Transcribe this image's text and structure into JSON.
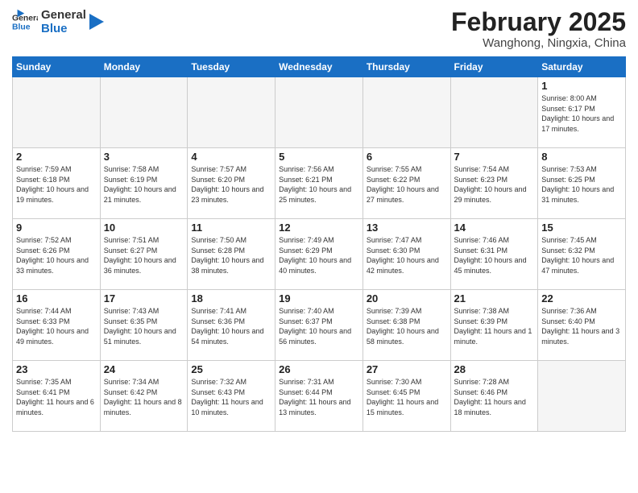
{
  "header": {
    "logo_general": "General",
    "logo_blue": "Blue",
    "month": "February 2025",
    "location": "Wanghong, Ningxia, China"
  },
  "weekdays": [
    "Sunday",
    "Monday",
    "Tuesday",
    "Wednesday",
    "Thursday",
    "Friday",
    "Saturday"
  ],
  "weeks": [
    [
      {
        "day": "",
        "info": ""
      },
      {
        "day": "",
        "info": ""
      },
      {
        "day": "",
        "info": ""
      },
      {
        "day": "",
        "info": ""
      },
      {
        "day": "",
        "info": ""
      },
      {
        "day": "",
        "info": ""
      },
      {
        "day": "1",
        "info": "Sunrise: 8:00 AM\nSunset: 6:17 PM\nDaylight: 10 hours\nand 17 minutes."
      }
    ],
    [
      {
        "day": "2",
        "info": "Sunrise: 7:59 AM\nSunset: 6:18 PM\nDaylight: 10 hours\nand 19 minutes."
      },
      {
        "day": "3",
        "info": "Sunrise: 7:58 AM\nSunset: 6:19 PM\nDaylight: 10 hours\nand 21 minutes."
      },
      {
        "day": "4",
        "info": "Sunrise: 7:57 AM\nSunset: 6:20 PM\nDaylight: 10 hours\nand 23 minutes."
      },
      {
        "day": "5",
        "info": "Sunrise: 7:56 AM\nSunset: 6:21 PM\nDaylight: 10 hours\nand 25 minutes."
      },
      {
        "day": "6",
        "info": "Sunrise: 7:55 AM\nSunset: 6:22 PM\nDaylight: 10 hours\nand 27 minutes."
      },
      {
        "day": "7",
        "info": "Sunrise: 7:54 AM\nSunset: 6:23 PM\nDaylight: 10 hours\nand 29 minutes."
      },
      {
        "day": "8",
        "info": "Sunrise: 7:53 AM\nSunset: 6:25 PM\nDaylight: 10 hours\nand 31 minutes."
      }
    ],
    [
      {
        "day": "9",
        "info": "Sunrise: 7:52 AM\nSunset: 6:26 PM\nDaylight: 10 hours\nand 33 minutes."
      },
      {
        "day": "10",
        "info": "Sunrise: 7:51 AM\nSunset: 6:27 PM\nDaylight: 10 hours\nand 36 minutes."
      },
      {
        "day": "11",
        "info": "Sunrise: 7:50 AM\nSunset: 6:28 PM\nDaylight: 10 hours\nand 38 minutes."
      },
      {
        "day": "12",
        "info": "Sunrise: 7:49 AM\nSunset: 6:29 PM\nDaylight: 10 hours\nand 40 minutes."
      },
      {
        "day": "13",
        "info": "Sunrise: 7:47 AM\nSunset: 6:30 PM\nDaylight: 10 hours\nand 42 minutes."
      },
      {
        "day": "14",
        "info": "Sunrise: 7:46 AM\nSunset: 6:31 PM\nDaylight: 10 hours\nand 45 minutes."
      },
      {
        "day": "15",
        "info": "Sunrise: 7:45 AM\nSunset: 6:32 PM\nDaylight: 10 hours\nand 47 minutes."
      }
    ],
    [
      {
        "day": "16",
        "info": "Sunrise: 7:44 AM\nSunset: 6:33 PM\nDaylight: 10 hours\nand 49 minutes."
      },
      {
        "day": "17",
        "info": "Sunrise: 7:43 AM\nSunset: 6:35 PM\nDaylight: 10 hours\nand 51 minutes."
      },
      {
        "day": "18",
        "info": "Sunrise: 7:41 AM\nSunset: 6:36 PM\nDaylight: 10 hours\nand 54 minutes."
      },
      {
        "day": "19",
        "info": "Sunrise: 7:40 AM\nSunset: 6:37 PM\nDaylight: 10 hours\nand 56 minutes."
      },
      {
        "day": "20",
        "info": "Sunrise: 7:39 AM\nSunset: 6:38 PM\nDaylight: 10 hours\nand 58 minutes."
      },
      {
        "day": "21",
        "info": "Sunrise: 7:38 AM\nSunset: 6:39 PM\nDaylight: 11 hours\nand 1 minute."
      },
      {
        "day": "22",
        "info": "Sunrise: 7:36 AM\nSunset: 6:40 PM\nDaylight: 11 hours\nand 3 minutes."
      }
    ],
    [
      {
        "day": "23",
        "info": "Sunrise: 7:35 AM\nSunset: 6:41 PM\nDaylight: 11 hours\nand 6 minutes."
      },
      {
        "day": "24",
        "info": "Sunrise: 7:34 AM\nSunset: 6:42 PM\nDaylight: 11 hours\nand 8 minutes."
      },
      {
        "day": "25",
        "info": "Sunrise: 7:32 AM\nSunset: 6:43 PM\nDaylight: 11 hours\nand 10 minutes."
      },
      {
        "day": "26",
        "info": "Sunrise: 7:31 AM\nSunset: 6:44 PM\nDaylight: 11 hours\nand 13 minutes."
      },
      {
        "day": "27",
        "info": "Sunrise: 7:30 AM\nSunset: 6:45 PM\nDaylight: 11 hours\nand 15 minutes."
      },
      {
        "day": "28",
        "info": "Sunrise: 7:28 AM\nSunset: 6:46 PM\nDaylight: 11 hours\nand 18 minutes."
      },
      {
        "day": "",
        "info": ""
      }
    ]
  ]
}
